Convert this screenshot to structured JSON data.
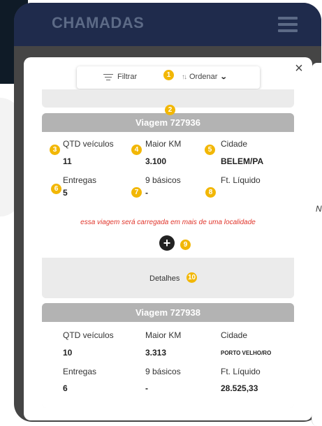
{
  "app": {
    "title": "CHAMADAS",
    "menu_icon": "hamburger-icon"
  },
  "modal": {
    "close_label": "×"
  },
  "toolbar": {
    "filter_label": "Filtrar",
    "sort_label": "Ordenar"
  },
  "badges": [
    "1",
    "2",
    "3",
    "4",
    "5",
    "6",
    "7",
    "8",
    "9",
    "10"
  ],
  "peek": {
    "letter": "N"
  },
  "trips": [
    {
      "title": "Viagem 727936",
      "qtd_label": "QTD veículos",
      "qtd_value": "11",
      "km_label": "Maior KM",
      "km_value": "3.100",
      "city_label": "Cidade",
      "city_value": "BELEM/PA",
      "deliveries_label": "Entregas",
      "deliveries_value": "5",
      "basics_label": "9 básicos",
      "basics_value": "-",
      "net_label": "Ft. Líquido",
      "net_value": "",
      "warning": "essa viagem será carregada em mais de uma localidade",
      "details_label": "Detalhes"
    },
    {
      "title": "Viagem 727938",
      "qtd_label": "QTD veículos",
      "qtd_value": "10",
      "km_label": "Maior KM",
      "km_value": "3.313",
      "city_label": "Cidade",
      "city_value": "PORTO VELHO/RO",
      "deliveries_label": "Entregas",
      "deliveries_value": "6",
      "basics_label": "9 básicos",
      "basics_value": "-",
      "net_label": "Ft. Líquido",
      "net_value": "28.525,33"
    }
  ],
  "colors": {
    "appbar": "#1f2b4c",
    "badge": "#f2b705",
    "card_header": "#b3b3b3",
    "warning": "#e0352b"
  }
}
